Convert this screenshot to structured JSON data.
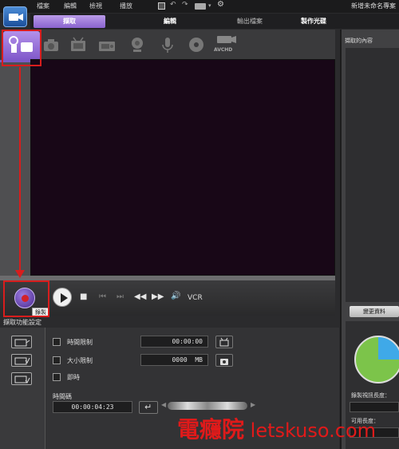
{
  "menu": {
    "items": [
      "檔案",
      "編輯",
      "檢視",
      "播放"
    ],
    "project_title": "新增未命名專案"
  },
  "tabs": [
    {
      "label": "擷取",
      "state": "active"
    },
    {
      "label": "編輯",
      "state": "bold"
    },
    {
      "label": "輸出檔案",
      "state": "normal"
    },
    {
      "label": "製作光碟",
      "state": "bold"
    }
  ],
  "sources": {
    "icons": [
      "camcorder-usb-icon",
      "camera-icon",
      "tv-icon",
      "dv-tv-icon",
      "webcam-icon",
      "microphone-icon",
      "disc-icon",
      "avchd-icon"
    ],
    "avchd_label": "AVCHD"
  },
  "controls": {
    "record_tooltip": "錄製",
    "vcr_label": "VCR"
  },
  "capture_settings": {
    "title": "擷取功能設定",
    "time_limit_label": "時間限制",
    "time_limit_value": "00:00:00",
    "size_limit_label": "大小限制",
    "size_limit_value": "0000  MB",
    "instant_label": "即時",
    "timecode_label": "時間碼",
    "timecode_value": "00:00:04:23"
  },
  "right_panel": {
    "title": "擷取的內容",
    "change_button": "變更資料",
    "record_quality_label": "錄製視訊長度：",
    "available_length_label": "可用長度："
  },
  "watermark": {
    "cjk": "電癮院",
    "latin": " letskuso.com"
  },
  "colors": {
    "accent_purple": "#8a63cf",
    "annotation_red": "#d81d1d",
    "preview_bg": "#180717"
  }
}
